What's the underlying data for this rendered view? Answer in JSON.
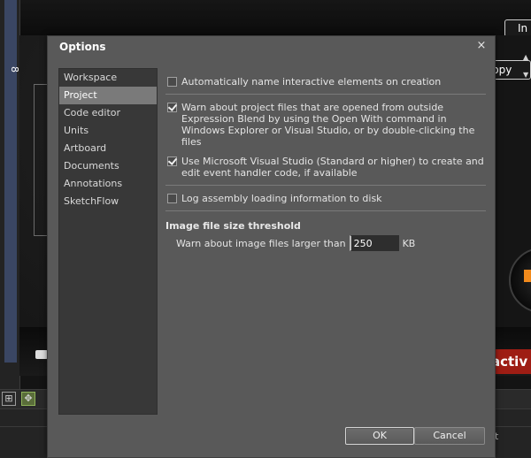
{
  "dialog": {
    "title": "Options",
    "close_glyph": "×",
    "categories": [
      {
        "label": "Workspace",
        "selected": false
      },
      {
        "label": "Project",
        "selected": true
      },
      {
        "label": "Code editor",
        "selected": false
      },
      {
        "label": "Units",
        "selected": false
      },
      {
        "label": "Artboard",
        "selected": false
      },
      {
        "label": "Documents",
        "selected": false
      },
      {
        "label": "Annotations",
        "selected": false
      },
      {
        "label": "SketchFlow",
        "selected": false
      }
    ],
    "options": [
      {
        "label": "Automatically name interactive elements on creation",
        "checked": false
      },
      {
        "label": "Warn about project files that are opened from outside Expression Blend by using the Open With command in Windows Explorer or Visual Studio, or by double-clicking the files",
        "checked": true
      },
      {
        "label": "Use Microsoft Visual Studio (Standard or higher) to create and edit event handler code, if available",
        "checked": true
      },
      {
        "label": "Log assembly loading information to disk",
        "checked": false
      }
    ],
    "threshold": {
      "section_title": "Image file size threshold",
      "label": "Warn about image files larger than",
      "value": "250",
      "unit": "KB"
    },
    "buttons": {
      "ok": "OK",
      "cancel": "Cancel"
    }
  },
  "background": {
    "top_button": "In",
    "copy_button": "ppy",
    "artboard_text": "activ",
    "vertical_label": "8",
    "bottom_text": "t"
  },
  "colors": {
    "dialog_bg": "#595959",
    "list_bg": "#383838",
    "selected_bg": "#7a7a7a",
    "accent_red": "#9e1d14",
    "accent_orange": "#f18a1c"
  }
}
